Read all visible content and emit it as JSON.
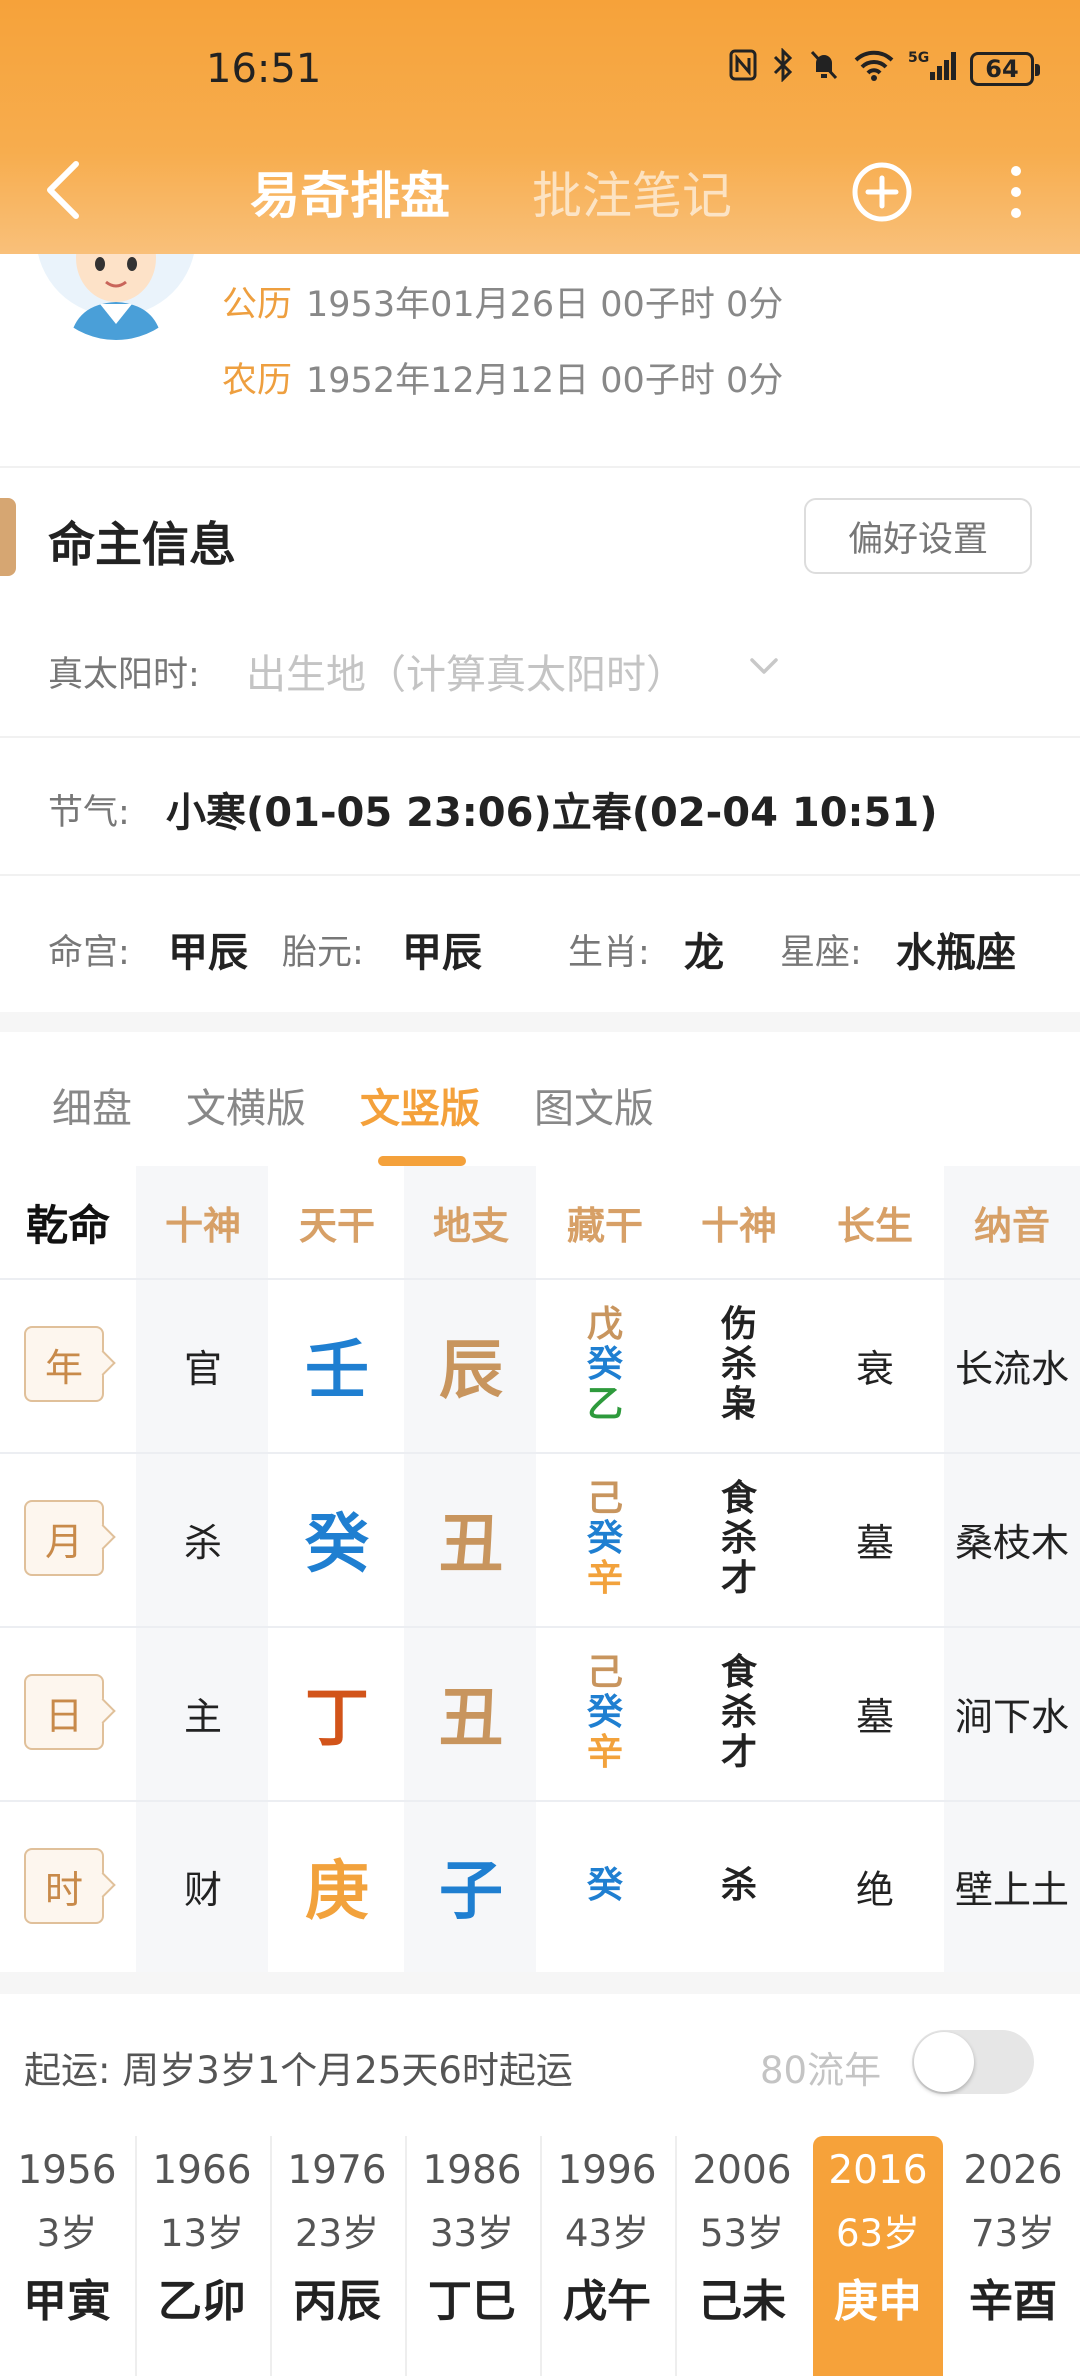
{
  "status_bar": {
    "time": "16:51",
    "battery": "64",
    "network": "5G"
  },
  "header": {
    "tabs": [
      {
        "label": "易奇排盘",
        "active": true
      },
      {
        "label": "批注笔记",
        "active": false
      }
    ],
    "icons": [
      "back-icon",
      "add-circle-icon",
      "more-vertical-icon"
    ]
  },
  "profile": {
    "solar_label": "公历",
    "solar_value": "1953年01月26日 00子时 0分",
    "lunar_label": "农历",
    "lunar_value": "1952年12月12日 00子时 0分"
  },
  "section": {
    "title": "命主信息",
    "pref_button": "偏好设置"
  },
  "info": {
    "true_solar_label": "真太阳时:",
    "true_solar_placeholder": "出生地（计算真太阳时）",
    "jieqi_label": "节气:",
    "jieqi_value": "小寒(01-05 23:06)立春(02-04 10:51)",
    "minggong_label": "命宫:",
    "minggong_value": "甲辰",
    "taiyuan_label": "胎元:",
    "taiyuan_value": "甲辰",
    "shengxiao_label": "生肖:",
    "shengxiao_value": "龙",
    "xingzuo_label": "星座:",
    "xingzuo_value": "水瓶座"
  },
  "subtabs": [
    {
      "label": "细盘",
      "active": false
    },
    {
      "label": "文横版",
      "active": false
    },
    {
      "label": "文竖版",
      "active": true
    },
    {
      "label": "图文版",
      "active": false
    }
  ],
  "grid": {
    "headers": [
      "乾命",
      "十神",
      "天干",
      "地支",
      "藏干",
      "十神",
      "长生",
      "纳音"
    ],
    "rows": [
      {
        "label": "年",
        "shishen": "官",
        "tiangan": "壬",
        "dizhi": "辰",
        "canggan": [
          "戊",
          "癸",
          "乙"
        ],
        "shishen2": [
          "伤",
          "杀",
          "枭"
        ],
        "changsheng": "衰",
        "nayin": "长流水"
      },
      {
        "label": "月",
        "shishen": "杀",
        "tiangan": "癸",
        "dizhi": "丑",
        "canggan": [
          "己",
          "癸",
          "辛"
        ],
        "shishen2": [
          "食",
          "杀",
          "才"
        ],
        "changsheng": "墓",
        "nayin": "桑枝木"
      },
      {
        "label": "日",
        "shishen": "主",
        "tiangan": "丁",
        "dizhi": "丑",
        "canggan": [
          "己",
          "癸",
          "辛"
        ],
        "shishen2": [
          "食",
          "杀",
          "才"
        ],
        "changsheng": "墓",
        "nayin": "涧下水"
      },
      {
        "label": "时",
        "shishen": "财",
        "tiangan": "庚",
        "dizhi": "子",
        "canggan": [
          "癸"
        ],
        "shishen2": [
          "杀"
        ],
        "changsheng": "绝",
        "nayin": "壁上土"
      }
    ],
    "element_colors": {
      "water": "#1f7fd1",
      "earth": "#c8955e",
      "fire": "#d2541a",
      "metal": "#f2a23c",
      "wood": "#2e9a3c"
    }
  },
  "qiyun": {
    "text": "起运:  周岁3岁1个月25天6时起运",
    "liunian_label": "80流年",
    "toggle_on": false
  },
  "dayun": [
    {
      "year": "1956",
      "age": "3岁",
      "ganzhi": "甲寅"
    },
    {
      "year": "1966",
      "age": "13岁",
      "ganzhi": "乙卯"
    },
    {
      "year": "1976",
      "age": "23岁",
      "ganzhi": "丙辰"
    },
    {
      "year": "1986",
      "age": "33岁",
      "ganzhi": "丁巳"
    },
    {
      "year": "1996",
      "age": "43岁",
      "ganzhi": "戊午"
    },
    {
      "year": "2006",
      "age": "53岁",
      "ganzhi": "己未"
    },
    {
      "year": "2016",
      "age": "63岁",
      "ganzhi": "庚申",
      "active": true
    },
    {
      "year": "2026",
      "age": "73岁",
      "ganzhi": "辛酉"
    }
  ],
  "colors": {
    "accent": "#f6a23a",
    "header_gradient_end": "#f9c07a",
    "label_brown": "#d7a067"
  }
}
